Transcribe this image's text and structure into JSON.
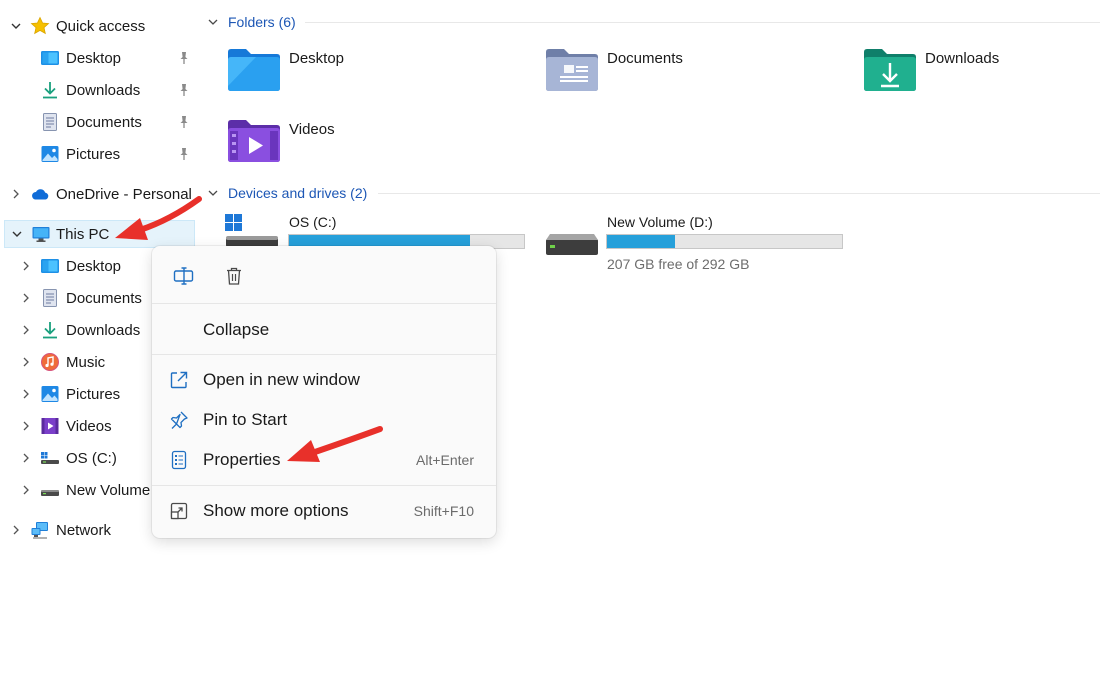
{
  "nav": {
    "quick_access": {
      "label": "Quick access",
      "items": [
        {
          "label": "Desktop"
        },
        {
          "label": "Downloads"
        },
        {
          "label": "Documents"
        },
        {
          "label": "Pictures"
        }
      ]
    },
    "onedrive": {
      "label": "OneDrive - Personal"
    },
    "this_pc": {
      "label": "This PC",
      "items": [
        {
          "label": "Desktop"
        },
        {
          "label": "Documents"
        },
        {
          "label": "Downloads"
        },
        {
          "label": "Music"
        },
        {
          "label": "Pictures"
        },
        {
          "label": "Videos"
        },
        {
          "label": "OS (C:)"
        },
        {
          "label": "New Volume"
        }
      ]
    },
    "network": {
      "label": "Network"
    }
  },
  "content": {
    "folders_heading": "Folders (6)",
    "folders": [
      {
        "label": "Desktop",
        "icon": "desktop-folder-icon"
      },
      {
        "label": "Documents",
        "icon": "documents-folder-icon"
      },
      {
        "label": "Downloads",
        "icon": "downloads-folder-icon"
      },
      {
        "label": "Videos",
        "icon": "videos-folder-icon"
      }
    ],
    "devices_heading": "Devices and drives (2)",
    "drives": [
      {
        "label": "OS (C:)",
        "used_fraction": 0.77,
        "free_text": ""
      },
      {
        "label": "New Volume (D:)",
        "used_fraction": 0.29,
        "free_text": "207 GB free of 292 GB"
      }
    ]
  },
  "context_menu": {
    "top_actions": [
      {
        "icon": "rename-icon"
      },
      {
        "icon": "delete-icon"
      }
    ],
    "items": [
      {
        "label": "Collapse",
        "shortcut": ""
      },
      {
        "label": "Open in new window",
        "shortcut": ""
      },
      {
        "label": "Pin to Start",
        "shortcut": ""
      },
      {
        "label": "Properties",
        "shortcut": "Alt+Enter"
      },
      {
        "label": "Show more options",
        "shortcut": "Shift+F10"
      }
    ]
  },
  "colors": {
    "accent_link": "#1d57b5",
    "selection_bg": "#e5f3fb",
    "drive_fill": "#26a0da",
    "annotation_arrow": "#e8302a"
  }
}
